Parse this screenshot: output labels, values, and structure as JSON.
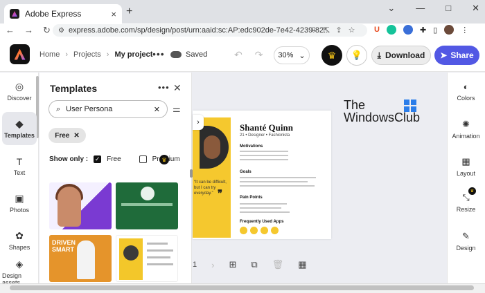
{
  "browser": {
    "tab_title": "Adobe Express",
    "tab_close": "×",
    "new_tab": "+",
    "window_controls": [
      "⌄",
      "—",
      "□",
      "✕"
    ],
    "nav": [
      "←",
      "→",
      "↻"
    ],
    "url": "express.adobe.com/sp/design/post/urn:aaid:sc:AP:edc902de-7e42-4239-82..."
  },
  "header": {
    "crumbs": [
      "Home",
      "Projects",
      "My project"
    ],
    "more": "•••",
    "saved": "Saved",
    "zoom": "30%",
    "download": "Download",
    "share": "Share"
  },
  "left_rail": [
    {
      "label": "Discover",
      "icon": "discover-icon",
      "glyph": "◎"
    },
    {
      "label": "Templates",
      "icon": "templates-icon",
      "glyph": "◆"
    },
    {
      "label": "Text",
      "icon": "text-icon",
      "glyph": "T"
    },
    {
      "label": "Photos",
      "icon": "photos-icon",
      "glyph": "▣"
    },
    {
      "label": "Shapes",
      "icon": "shapes-icon",
      "glyph": "✿"
    },
    {
      "label": "Design assets",
      "icon": "design-assets-icon",
      "glyph": "◈"
    }
  ],
  "panel": {
    "title": "Templates",
    "search_value": "User Persona",
    "filter_chip": "Free",
    "show_only_label": "Show only :",
    "options": [
      {
        "label": "Free",
        "checked": true
      },
      {
        "label": "Premium",
        "checked": false
      }
    ]
  },
  "template_thumbs": {
    "t3_text": "DRIVEN SMART"
  },
  "canvas_page": {
    "name": "Shanté Quinn",
    "subtitle": "21 • Designer • Fashionista",
    "sections": [
      "Motivations",
      "Goals",
      "Pain Points",
      "Frequently Used Apps"
    ],
    "quote": "“It can be difficult, but I can try everyday.”",
    "quote_mark": "❞"
  },
  "pagebar": {
    "page_number": "1"
  },
  "watermark": {
    "line1": "The",
    "line2": "WindowsClub"
  },
  "right_rail": [
    {
      "label": "Colors",
      "icon": "colors-icon",
      "glyph": "◐"
    },
    {
      "label": "Animation",
      "icon": "animation-icon",
      "glyph": "✺"
    },
    {
      "label": "Layout",
      "icon": "layout-icon",
      "glyph": "▦"
    },
    {
      "label": "Resize",
      "icon": "resize-icon",
      "glyph": "⤡"
    },
    {
      "label": "Design",
      "icon": "design-icon",
      "glyph": "✎"
    }
  ],
  "colors": {
    "share": "#5258e4",
    "crown": "#f5c518",
    "persona_yellow": "#f5c82e",
    "thumb_green": "#1f6b3a",
    "thumb_purple": "#7a3ad2",
    "thumb_orange": "#e5942b"
  }
}
